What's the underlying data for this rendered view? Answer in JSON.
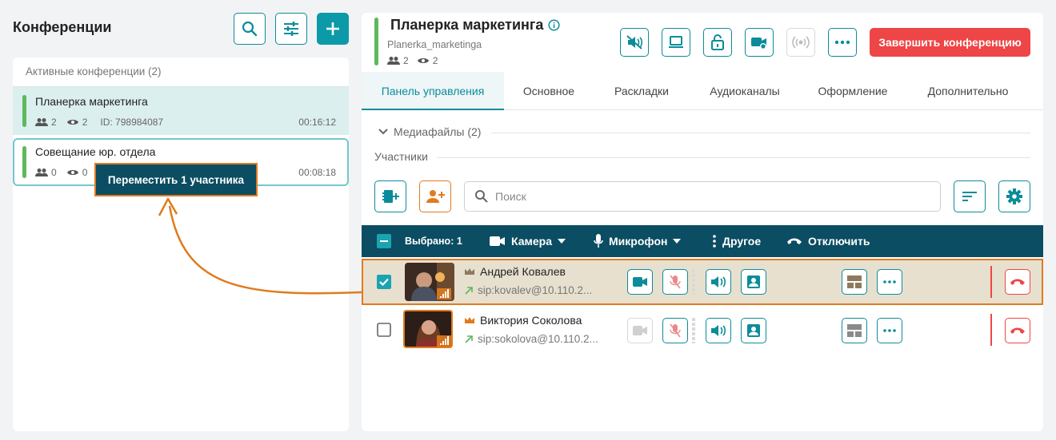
{
  "left": {
    "title": "Конференции",
    "section_title": "Активные конференции (2)",
    "conferences": [
      {
        "name": "Планерка маркетинга",
        "participants": "2",
        "viewers": "2",
        "id_text": "ID: 798984087",
        "time": "00:16:12"
      },
      {
        "name": "Совещание юр. отдела",
        "participants": "0",
        "viewers": "0",
        "time": "00:08:18"
      }
    ],
    "tooltip": "Переместить 1 участника"
  },
  "header": {
    "title": "Планерка маркетинга",
    "login": "Planerka_marketinga",
    "participants": "2",
    "viewers": "2",
    "end_label": "Завершить конференцию"
  },
  "tabs": [
    "Панель управления",
    "Основное",
    "Раскладки",
    "Аудиоканалы",
    "Оформление",
    "Дополнительно"
  ],
  "media_label": "Медиафайлы (2)",
  "participants_label": "Участники",
  "search": {
    "placeholder": "Поиск"
  },
  "selection_bar": {
    "selected": "Выбрано: 1",
    "camera": "Камера",
    "microphone": "Микрофон",
    "other": "Другое",
    "disconnect": "Отключить"
  },
  "participants": [
    {
      "name": "Андрей Ковалев",
      "sip": "sip:kovalev@10.110.2...",
      "checked": true
    },
    {
      "name": "Виктория Соколова",
      "sip": "sip:sokolova@10.110.2...",
      "checked": false
    }
  ],
  "colors": {
    "accent": "#0c8c9a",
    "danger": "#ee4546",
    "highlight": "#e07b1e",
    "dark": "#0b4d62",
    "status_green": "#5fb85d"
  }
}
